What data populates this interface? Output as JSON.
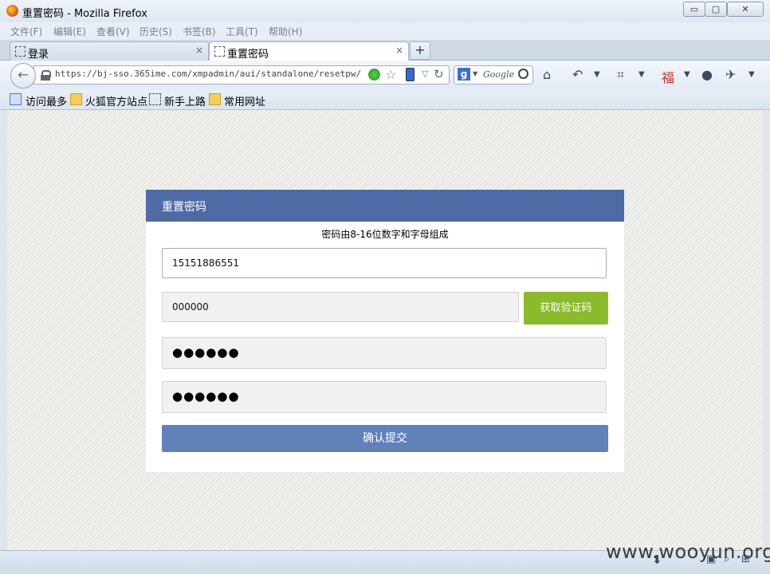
{
  "window": {
    "title": "重置密码 - Mozilla Firefox",
    "min_symbol": "▭",
    "max_symbol": "▢",
    "close_symbol": "✕"
  },
  "menu": {
    "items": [
      "文件(F)",
      "编辑(E)",
      "查看(V)",
      "历史(S)",
      "书签(B)",
      "工具(T)",
      "帮助(H)"
    ]
  },
  "tabs": [
    {
      "label": "登录",
      "close": "×"
    },
    {
      "label": "重置密码",
      "close": "×"
    }
  ],
  "new_tab": "+",
  "navbar": {
    "back": "←",
    "url": "https://bj-sso.365ime.com/xmpadmin/aui/standalone/resetpw/",
    "search_placeholder": "Google",
    "search_engine_glyph": "g"
  },
  "bookmarks": {
    "items": [
      "访问最多",
      "火狐官方站点",
      "新手上路",
      "常用网址"
    ]
  },
  "form": {
    "title": "重置密码",
    "hint": "密码由8-16位数字和字母组成",
    "phone_value": "15151886551",
    "code_value": "000000",
    "get_code_label": "获取验证码",
    "password_mask": "●●●●●●",
    "confirm_mask": "●●●●●●",
    "submit_label": "确认提交"
  },
  "watermark": "www.wooyun.org",
  "colors": {
    "header": "#4e6ba6",
    "get_code": "#8bba2c",
    "submit": "#6080b9"
  }
}
